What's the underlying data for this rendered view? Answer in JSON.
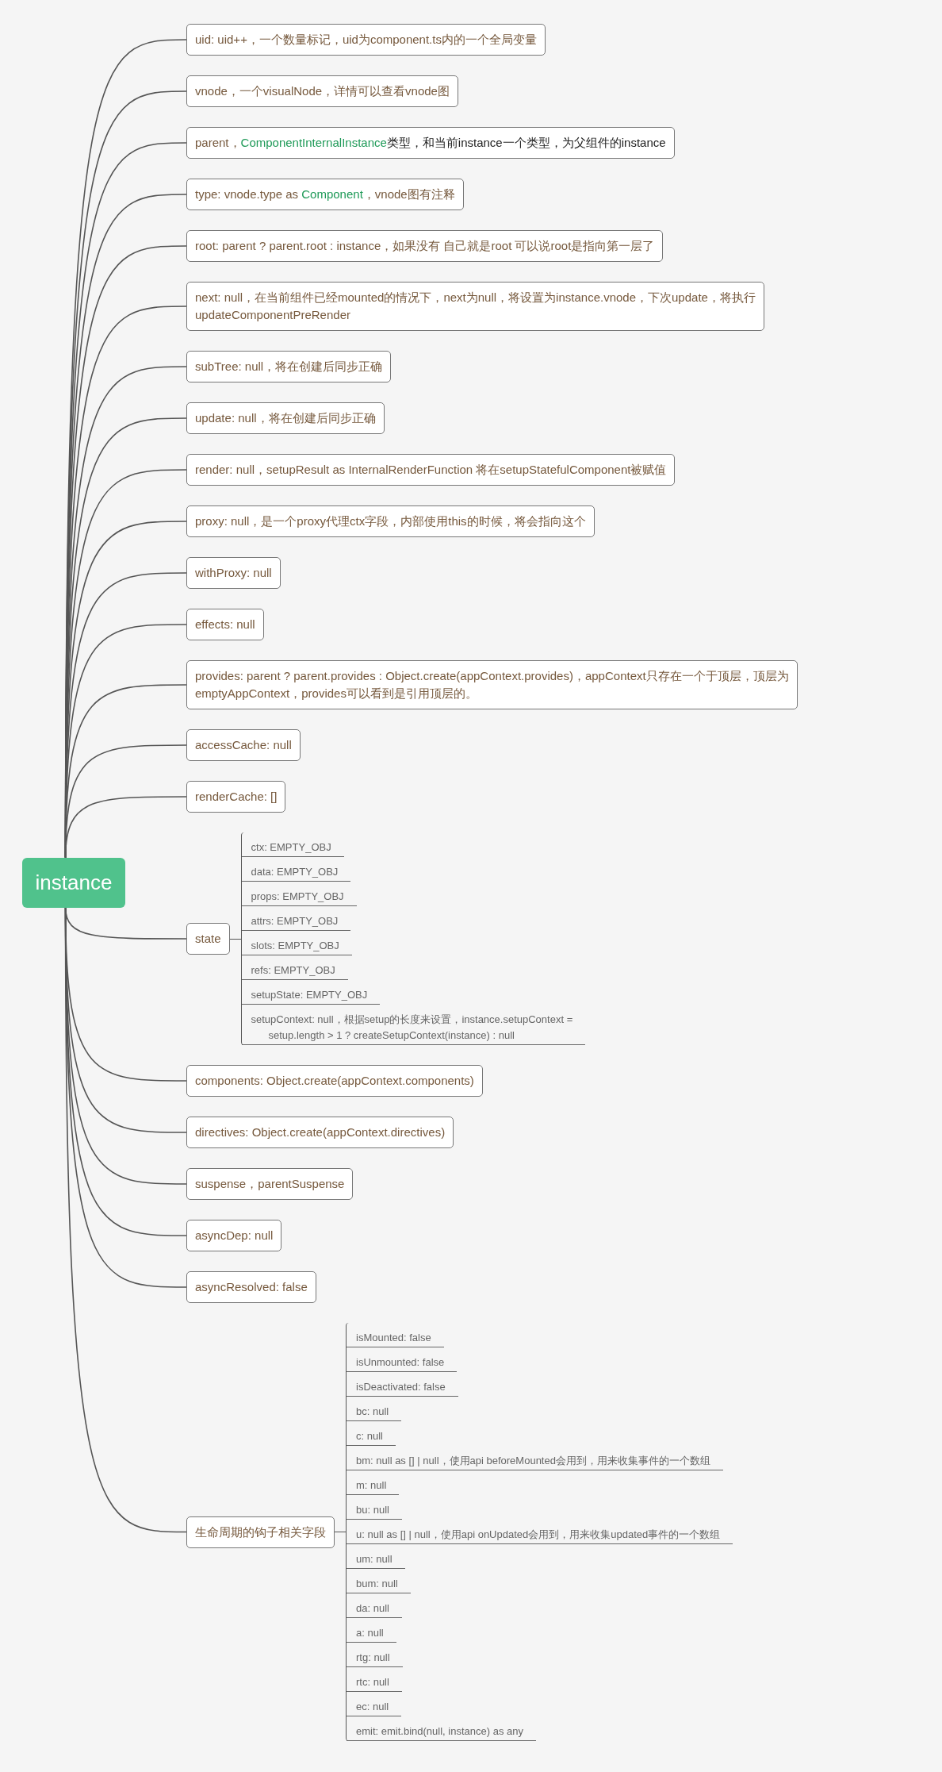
{
  "root": {
    "title": "instance"
  },
  "branches": [
    {
      "text": "uid: uid++，一个数量标记，uid为component.ts内的一个全局变量"
    },
    {
      "text": "vnode，一个visualNode，详情可以查看vnode图"
    },
    {
      "segments": [
        {
          "kind": "plain",
          "text": "parent，"
        },
        {
          "kind": "type",
          "text": "ComponentInternalInstance"
        },
        {
          "kind": "dark",
          "text": "类型，和当前instance一个类型，为父组件的instance"
        }
      ]
    },
    {
      "segments": [
        {
          "kind": "plain",
          "text": "type: vnode.type as "
        },
        {
          "kind": "type",
          "text": "Component"
        },
        {
          "kind": "plain",
          "text": "，vnode图有注释"
        }
      ]
    },
    {
      "text": "root: parent ? parent.root : instance，如果没有 自己就是root 可以说root是指向第一层了"
    },
    {
      "text": "next: null，在当前组件已经mounted的情况下，next为null，将设置为instance.vnode，下次update，将执行\nupdateComponentPreRender"
    },
    {
      "text": "subTree: null，将在创建后同步正确"
    },
    {
      "text": "update: null，将在创建后同步正确"
    },
    {
      "text": "render: null，setupResult as InternalRenderFunction 将在setupStatefulComponent被赋值"
    },
    {
      "text": "proxy: null，是一个proxy代理ctx字段，内部使用this的时候，将会指向这个"
    },
    {
      "text": "withProxy: null"
    },
    {
      "text": "effects: null"
    },
    {
      "text": "provides: parent ? parent.provides : Object.create(appContext.provides)，appContext只存在一个于顶层，顶层为\nemptyAppContext，provides可以看到是引用顶层的。"
    },
    {
      "text": "accessCache: null"
    },
    {
      "text": "renderCache: []"
    },
    {
      "text": "state",
      "children": [
        {
          "text": "ctx: EMPTY_OBJ"
        },
        {
          "text": "data: EMPTY_OBJ"
        },
        {
          "text": "props: EMPTY_OBJ"
        },
        {
          "text": "attrs: EMPTY_OBJ"
        },
        {
          "text": "slots: EMPTY_OBJ"
        },
        {
          "text": "refs: EMPTY_OBJ"
        },
        {
          "text": "setupState: EMPTY_OBJ"
        },
        {
          "text": "setupContext: null，根据setup的长度来设置，instance.setupContext =\nsetup.length > 1 ? createSetupContext(instance) : null"
        }
      ]
    },
    {
      "text": "components: Object.create(appContext.components)"
    },
    {
      "text": "directives: Object.create(appContext.directives)"
    },
    {
      "text": "suspense，parentSuspense"
    },
    {
      "text": "asyncDep: null"
    },
    {
      "text": "asyncResolved: false"
    },
    {
      "text": "生命周期的钩子相关字段",
      "children": [
        {
          "text": "isMounted: false"
        },
        {
          "text": "isUnmounted: false"
        },
        {
          "text": "isDeactivated: false"
        },
        {
          "text": "bc: null"
        },
        {
          "text": "c: null"
        },
        {
          "text": "bm: null as [] | null，使用api beforeMounted会用到，用来收集事件的一个数组"
        },
        {
          "text": "m: null"
        },
        {
          "text": "bu: null"
        },
        {
          "text": "u: null as [] | null，使用api onUpdated会用到，用来收集updated事件的一个数组"
        },
        {
          "text": "um: null"
        },
        {
          "text": "bum: null"
        },
        {
          "text": "da: null"
        },
        {
          "text": "a: null"
        },
        {
          "text": "rtg: null"
        },
        {
          "text": "rtc: null"
        },
        {
          "text": "ec: null"
        },
        {
          "text": "emit: emit.bind(null, instance) as any"
        }
      ]
    }
  ]
}
